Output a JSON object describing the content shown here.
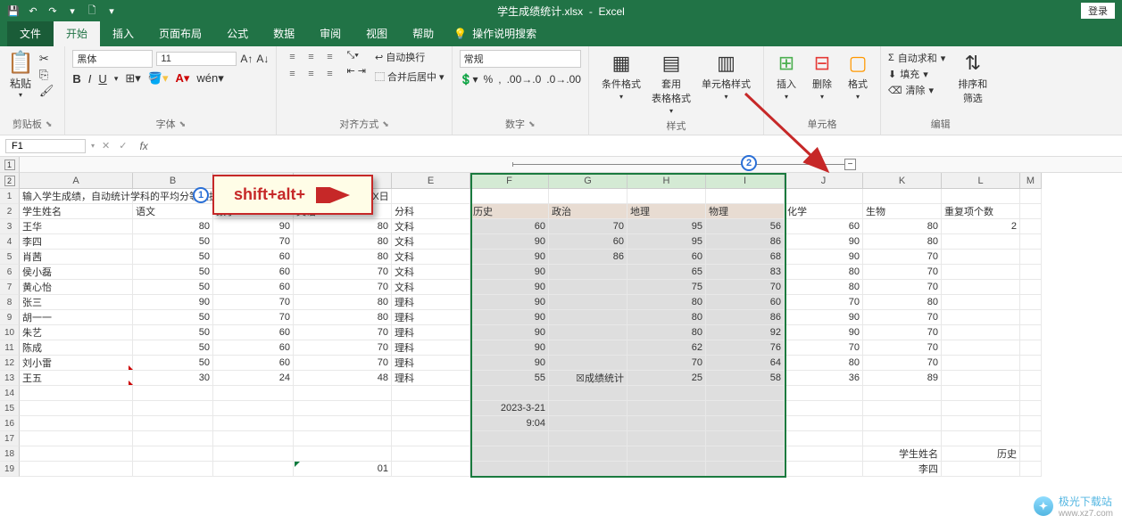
{
  "titlebar": {
    "filename": "学生成绩统计.xlsx",
    "app": "Excel",
    "login": "登录"
  },
  "tabs": {
    "file": "文件",
    "home": "开始",
    "insert": "插入",
    "layout": "页面布局",
    "formulas": "公式",
    "data": "数据",
    "review": "审阅",
    "view": "视图",
    "help": "帮助",
    "search": "操作说明搜索"
  },
  "ribbon": {
    "clipboard": {
      "paste": "粘贴",
      "label": "剪贴板"
    },
    "font": {
      "name": "黑体",
      "size": "11",
      "label": "字体"
    },
    "align": {
      "wrap": "自动换行",
      "merge": "合并后居中",
      "label": "对齐方式"
    },
    "number": {
      "format": "常规",
      "label": "数字"
    },
    "styles": {
      "cond": "条件格式",
      "table": "套用\n表格格式",
      "cell": "单元格样式",
      "label": "样式"
    },
    "cells": {
      "insert": "插入",
      "delete": "删除",
      "format": "格式",
      "label": "单元格"
    },
    "editing": {
      "sum": "自动求和",
      "fill": "填充",
      "clear": "清除",
      "sort": "排序和\n筛选",
      "label": "编辑"
    }
  },
  "formula_bar": {
    "namebox": "F1"
  },
  "tip": {
    "text": "shift+alt+"
  },
  "columns": [
    "A",
    "B",
    "C",
    "D",
    "E",
    "F",
    "G",
    "H",
    "I",
    "J",
    "K",
    "L",
    "M"
  ],
  "col_widths": [
    "cw-A",
    "cw-B",
    "cw-C",
    "cw-D",
    "cw-E",
    "cw-F",
    "cw-G",
    "cw-H",
    "cw-I",
    "cw-J",
    "cw-K",
    "cw-L",
    "cw-M"
  ],
  "selected_cols": [
    5,
    6,
    7,
    8
  ],
  "rows": [
    {
      "n": 1,
      "cells": [
        "输入学生成绩，自动统计学科的平均分等数据。班级：X年X班统计日期：X年X月X日",
        "",
        "",
        "",
        "",
        "",
        "",
        "",
        "",
        "",
        "",
        "",
        ""
      ],
      "span0": 5
    },
    {
      "n": 2,
      "cells": [
        "学生姓名",
        "语文",
        "数学",
        "英语",
        "分科",
        "历史",
        "政治",
        "地理",
        "物理",
        "化学",
        "生物",
        "重复项个数",
        ""
      ],
      "fillcols": [
        5,
        6,
        7,
        8
      ]
    },
    {
      "n": 3,
      "cells": [
        "王华",
        "80",
        "90",
        "80",
        "文科",
        "60",
        "70",
        "95",
        "56",
        "60",
        "80",
        "2",
        ""
      ]
    },
    {
      "n": 4,
      "cells": [
        "李四",
        "50",
        "70",
        "80",
        "文科",
        "90",
        "60",
        "95",
        "86",
        "90",
        "80",
        "",
        ""
      ]
    },
    {
      "n": 5,
      "cells": [
        "肖茜",
        "50",
        "60",
        "80",
        "文科",
        "90",
        "86",
        "60",
        "68",
        "90",
        "70",
        "",
        ""
      ]
    },
    {
      "n": 6,
      "cells": [
        "侯小磊",
        "50",
        "60",
        "70",
        "文科",
        "90",
        "",
        "65",
        "83",
        "80",
        "70",
        "",
        ""
      ]
    },
    {
      "n": 7,
      "cells": [
        "黄心怡",
        "50",
        "60",
        "70",
        "文科",
        "90",
        "",
        "75",
        "70",
        "80",
        "70",
        "",
        ""
      ]
    },
    {
      "n": 8,
      "cells": [
        "张三",
        "90",
        "70",
        "80",
        "理科",
        "90",
        "",
        "80",
        "60",
        "70",
        "80",
        "",
        ""
      ]
    },
    {
      "n": 9,
      "cells": [
        "胡一一",
        "50",
        "70",
        "80",
        "理科",
        "90",
        "",
        "80",
        "86",
        "90",
        "70",
        "",
        ""
      ]
    },
    {
      "n": 10,
      "cells": [
        "朱艺",
        "50",
        "60",
        "70",
        "理科",
        "90",
        "",
        "80",
        "92",
        "90",
        "70",
        "",
        ""
      ]
    },
    {
      "n": 11,
      "cells": [
        "陈成",
        "50",
        "60",
        "70",
        "理科",
        "90",
        "",
        "62",
        "76",
        "70",
        "70",
        "",
        ""
      ]
    },
    {
      "n": 12,
      "cells": [
        "刘小雷",
        "50",
        "60",
        "70",
        "理科",
        "90",
        "",
        "70",
        "64",
        "80",
        "70",
        "",
        ""
      ]
    },
    {
      "n": 13,
      "cells": [
        "王五",
        "30",
        "24",
        "48",
        "理科",
        "55",
        "☒成绩统计",
        "25",
        "58",
        "36",
        "89",
        "",
        ""
      ]
    },
    {
      "n": 14,
      "cells": [
        "",
        "",
        "",
        "",
        "",
        "",
        "",
        "",
        "",
        "",
        "",
        "",
        ""
      ]
    },
    {
      "n": 15,
      "cells": [
        "",
        "",
        "",
        "",
        "",
        "2023-3-21",
        "",
        "",
        "",
        "",
        "",
        "",
        ""
      ]
    },
    {
      "n": 16,
      "cells": [
        "",
        "",
        "",
        "",
        "",
        "9:04",
        "",
        "",
        "",
        "",
        "",
        "",
        ""
      ]
    },
    {
      "n": 17,
      "cells": [
        "",
        "",
        "",
        "",
        "",
        "",
        "",
        "",
        "",
        "",
        "",
        "",
        ""
      ]
    },
    {
      "n": 18,
      "cells": [
        "",
        "",
        "",
        "",
        "",
        "",
        "",
        "",
        "",
        "",
        "学生姓名",
        "历史",
        ""
      ]
    },
    {
      "n": 19,
      "cells": [
        "",
        "",
        "",
        "01",
        "",
        "",
        "",
        "",
        "",
        "",
        "李四",
        "",
        ""
      ]
    }
  ],
  "numeric_cols": [
    1,
    2,
    3,
    5,
    6,
    7,
    8,
    9,
    10,
    11
  ],
  "watermark": {
    "brand": "极光下载站",
    "url": "www.xz7.com"
  }
}
